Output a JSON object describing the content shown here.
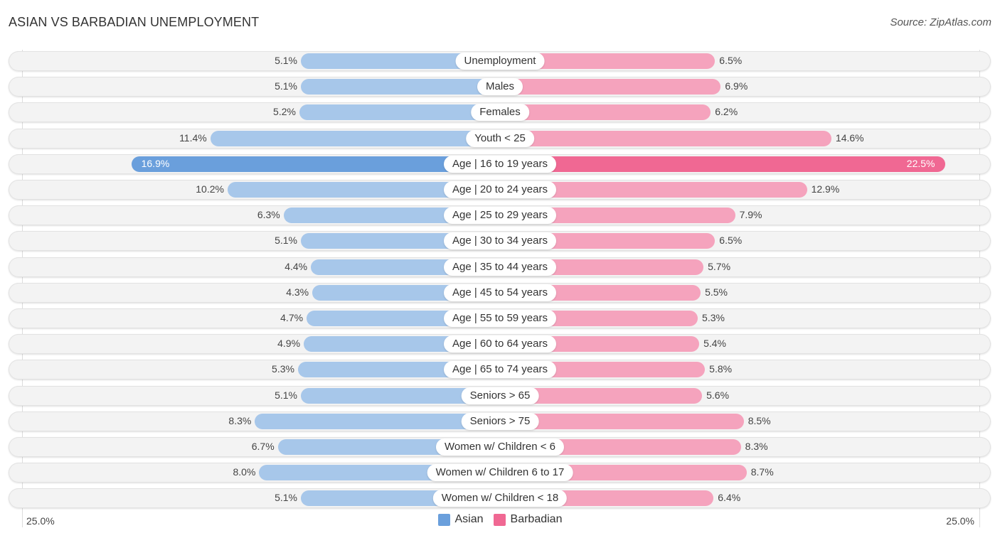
{
  "title": "ASIAN VS BARBADIAN UNEMPLOYMENT",
  "source": "Source: ZipAtlas.com",
  "colors": {
    "asian": "#a7c7ea",
    "asian_highlight": "#6a9fdc",
    "barbadian": "#f5a3bd",
    "barbadian_highlight": "#f06893",
    "legend_asian": "#6a9fdc",
    "legend_barbadian": "#f06893"
  },
  "chart_data": {
    "type": "bar",
    "orientation": "horizontal-diverging",
    "title": "ASIAN VS BARBADIAN UNEMPLOYMENT",
    "xlim": [
      -25,
      25
    ],
    "axis_labels": {
      "left": "25.0%",
      "right": "25.0%"
    },
    "legend": {
      "position": "bottom-center",
      "entries": [
        "Asian",
        "Barbadian"
      ]
    },
    "categories": [
      "Unemployment",
      "Males",
      "Females",
      "Youth < 25",
      "Age | 16 to 19 years",
      "Age | 20 to 24 years",
      "Age | 25 to 29 years",
      "Age | 30 to 34 years",
      "Age | 35 to 44 years",
      "Age | 45 to 54 years",
      "Age | 55 to 59 years",
      "Age | 60 to 64 years",
      "Age | 65 to 74 years",
      "Seniors > 65",
      "Seniors > 75",
      "Women w/ Children < 6",
      "Women w/ Children 6 to 17",
      "Women w/ Children < 18"
    ],
    "series": [
      {
        "name": "Asian",
        "values": [
          5.1,
          5.1,
          5.2,
          11.4,
          16.9,
          10.2,
          6.3,
          5.1,
          4.4,
          4.3,
          4.7,
          4.9,
          5.3,
          5.1,
          8.3,
          6.7,
          8.0,
          5.1
        ],
        "labels": [
          "5.1%",
          "5.1%",
          "5.2%",
          "11.4%",
          "16.9%",
          "10.2%",
          "6.3%",
          "5.1%",
          "4.4%",
          "4.3%",
          "4.7%",
          "4.9%",
          "5.3%",
          "5.1%",
          "8.3%",
          "6.7%",
          "8.0%",
          "5.1%"
        ]
      },
      {
        "name": "Barbadian",
        "values": [
          6.5,
          6.9,
          6.2,
          14.6,
          22.5,
          12.9,
          7.9,
          6.5,
          5.7,
          5.5,
          5.3,
          5.4,
          5.8,
          5.6,
          8.5,
          8.3,
          8.7,
          6.4
        ],
        "labels": [
          "6.5%",
          "6.9%",
          "6.2%",
          "14.6%",
          "22.5%",
          "12.9%",
          "7.9%",
          "6.5%",
          "5.7%",
          "5.5%",
          "5.3%",
          "5.4%",
          "5.8%",
          "5.6%",
          "8.5%",
          "8.3%",
          "8.7%",
          "6.4%"
        ]
      }
    ],
    "highlighted_index": 4
  }
}
